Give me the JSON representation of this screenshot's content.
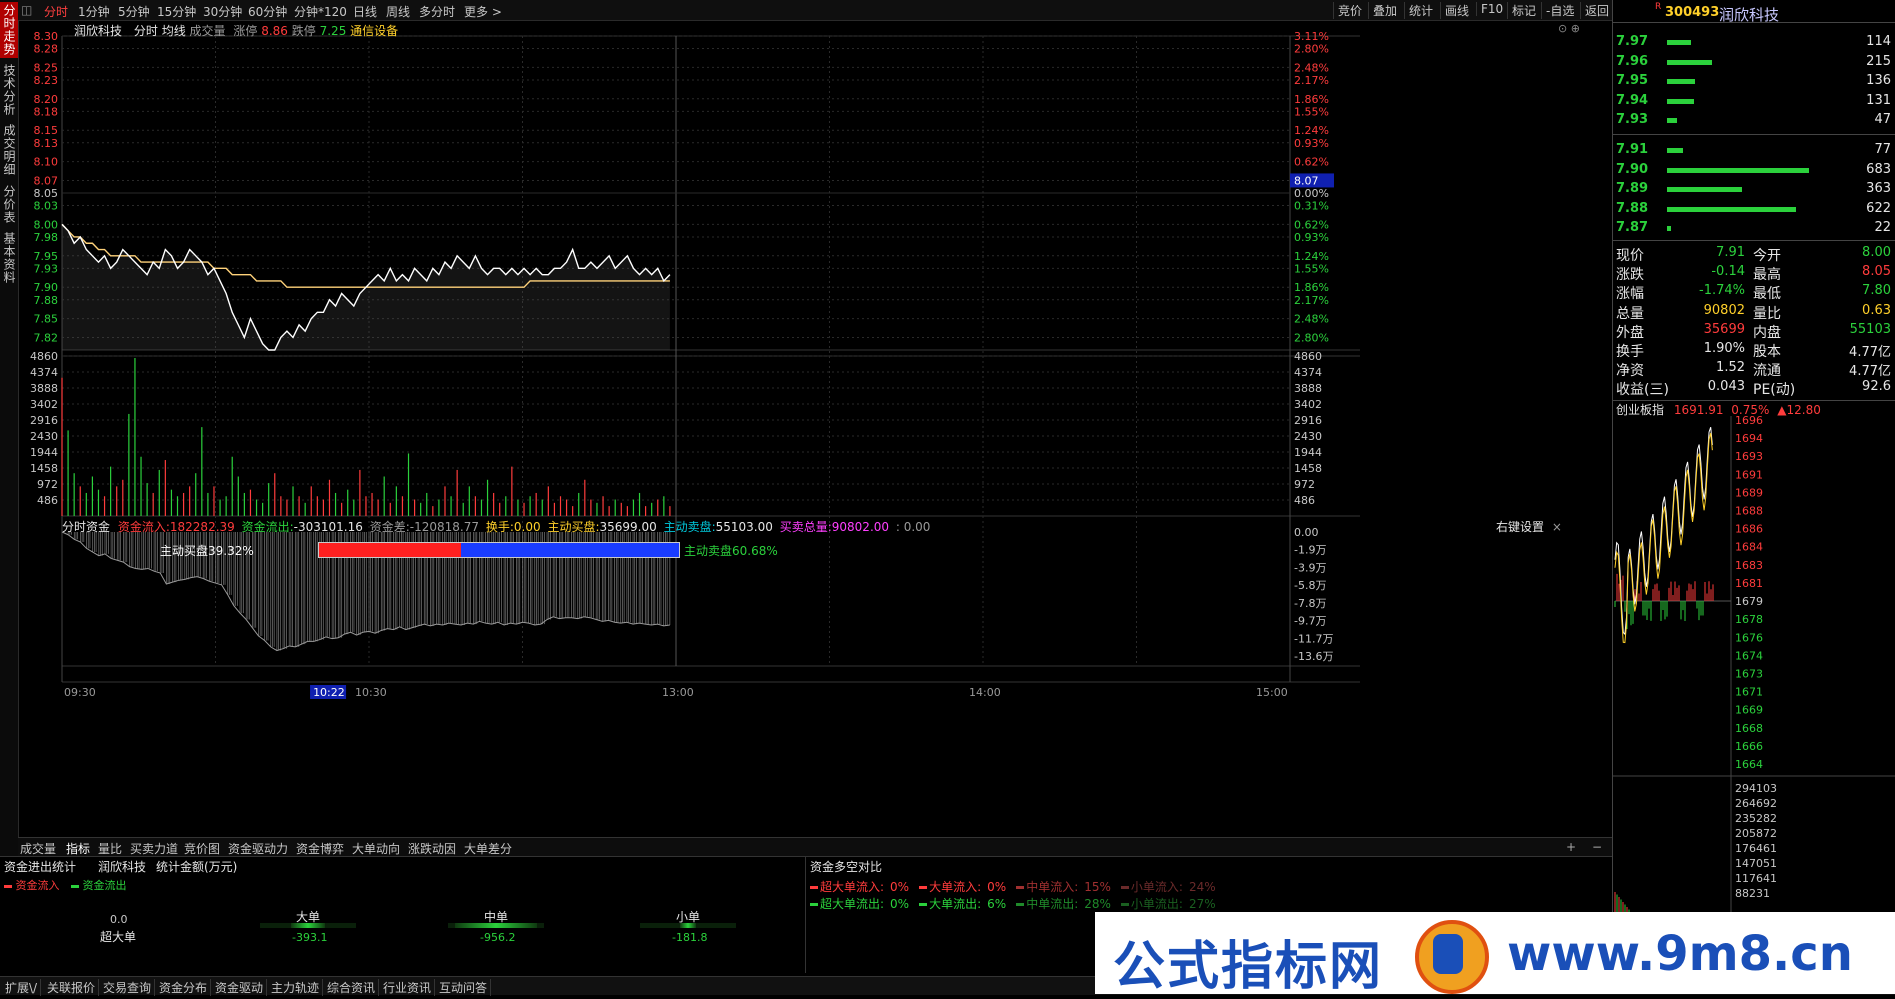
{
  "left_tabs": [
    "分时走势",
    "技术分析",
    "成交明细",
    "分价表",
    "基本资料"
  ],
  "top_toolbar": {
    "periods": [
      "分时",
      "1分钟",
      "5分钟",
      "15分钟",
      "30分钟",
      "60分钟",
      "分钟*120",
      "日线",
      "周线",
      "多分时",
      "更多 >"
    ],
    "right_buttons": [
      "竞价",
      "叠加",
      "统计",
      "画线",
      "F10",
      "标记",
      "-自选",
      "返回"
    ]
  },
  "price_header": {
    "name": "润欣科技",
    "items": [
      "分时",
      "均线",
      "成交量"
    ],
    "limit_up_label": "涨停",
    "limit_up": "8.86",
    "limit_down_label": "跌停",
    "limit_down": "7.25",
    "industry": "通信设备"
  },
  "price_axis": {
    "left_ticks": [
      "8.30",
      "8.28",
      "8.25",
      "8.23",
      "8.20",
      "8.18",
      "8.15",
      "8.13",
      "8.10",
      "8.07",
      "8.05",
      "8.03",
      "8.00",
      "7.98",
      "7.95",
      "7.93",
      "7.90",
      "7.88",
      "7.85",
      "7.82"
    ],
    "right_ticks": [
      "3.11%",
      "2.80%",
      "2.48%",
      "2.17%",
      "1.86%",
      "1.55%",
      "1.24%",
      "0.93%",
      "0.62%",
      "",
      "0.00%",
      "0.31%",
      "0.62%",
      "0.93%",
      "1.24%",
      "1.55%",
      "1.86%",
      "2.17%",
      "2.48%",
      "2.80%"
    ],
    "cursor_price": "8.07"
  },
  "volume_axis": {
    "ticks": [
      "4860",
      "4374",
      "3888",
      "3402",
      "2916",
      "2430",
      "1944",
      "1458",
      "972",
      "486"
    ]
  },
  "fund_header": {
    "title": "分时资金",
    "inflow_label": "资金流入:",
    "inflow": "182282.39",
    "outflow_label": "资金流出:",
    "outflow": "-303101.16",
    "diff_label": "资金差:",
    "diff": "-120818.77",
    "turnover_label": "换手:",
    "turnover": "0.00",
    "active_buy_label": "主动买盘:",
    "active_buy": "35699.00",
    "active_sell_label": "主动卖盘:",
    "active_sell": "55103.00",
    "total_label": "买卖总量:",
    "total": "90802.00",
    "extra": ": 0.00",
    "settings": "右键设置"
  },
  "fund_axis": {
    "ticks": [
      "0.00",
      "-1.9万",
      "-3.9万",
      "-5.8万",
      "-7.8万",
      "-9.7万",
      "-11.7万",
      "-13.6万"
    ]
  },
  "buy_sell_bar": {
    "buy_label": "主动买盘39.32%",
    "sell_label": "主动卖盘60.68%",
    "buy_fraction": 0.3932
  },
  "time_axis": {
    "labels": [
      "09:30",
      "10:30",
      "13:00",
      "14:00",
      "15:00"
    ],
    "cursor": "10:22"
  },
  "bottom_tabs": [
    "成交量",
    "指标",
    "量比",
    "买卖力道",
    "竞价图",
    "资金驱动力",
    "资金博弈",
    "大单动向",
    "涨跌动因",
    "大单差分"
  ],
  "fund_stats": {
    "title": "资金进出统计",
    "stock": "润欣科技",
    "unit": "统计金额(万元)",
    "legend_in": "资金流入",
    "legend_out": "资金流出",
    "groups": [
      {
        "name": "超大单",
        "value": "0.0",
        "out": "",
        "fill": 0.0
      },
      {
        "name": "大单",
        "value": "",
        "out": "-393.1",
        "fill": 0.35
      },
      {
        "name": "中单",
        "value": "",
        "out": "-956.2",
        "fill": 0.85
      },
      {
        "name": "小单",
        "value": "",
        "out": "-181.8",
        "fill": 0.16
      }
    ]
  },
  "fund_compare": {
    "title": "资金多空对比",
    "row1": [
      {
        "label": "超大单流入:",
        "value": "0%",
        "color": "#ff3c3c"
      },
      {
        "label": "大单流入:",
        "value": "0%",
        "color": "#ff3c3c"
      },
      {
        "label": "中单流入:",
        "value": "15%",
        "color": "#a03030"
      },
      {
        "label": "小单流入:",
        "value": "24%",
        "color": "#6a2a2a"
      }
    ],
    "row2": [
      {
        "label": "超大单流出:",
        "value": "0%",
        "color": "#2bd13c"
      },
      {
        "label": "大单流出:",
        "value": "6%",
        "color": "#2bd13c"
      },
      {
        "label": "中单流出:",
        "value": "28%",
        "color": "#1f8a2a"
      },
      {
        "label": "小单流出:",
        "value": "27%",
        "color": "#1a5f20"
      }
    ]
  },
  "status_bar": [
    "扩展\\/",
    "关联报价",
    "交易查询",
    "资金分布",
    "资金驱动",
    "主力轨迹",
    "综合资讯",
    "行业资讯",
    "互动问答"
  ],
  "quote": {
    "code": "300493",
    "name": "润欣科技",
    "badge": "R",
    "asks": [
      {
        "price": "7.97",
        "vol": "114",
        "fill": 0.17
      },
      {
        "price": "7.96",
        "vol": "215",
        "fill": 0.32
      },
      {
        "price": "7.95",
        "vol": "136",
        "fill": 0.2
      },
      {
        "price": "7.94",
        "vol": "131",
        "fill": 0.19
      },
      {
        "price": "7.93",
        "vol": "47",
        "fill": 0.07
      }
    ],
    "bids": [
      {
        "price": "7.91",
        "vol": "77",
        "fill": 0.11
      },
      {
        "price": "7.90",
        "vol": "683",
        "fill": 1.0
      },
      {
        "price": "7.89",
        "vol": "363",
        "fill": 0.53
      },
      {
        "price": "7.88",
        "vol": "622",
        "fill": 0.91
      },
      {
        "price": "7.87",
        "vol": "22",
        "fill": 0.03
      }
    ],
    "stats": [
      {
        "l1": "现价",
        "v1": "7.91",
        "c1": "#2bd13c",
        "l2": "今开",
        "v2": "8.00",
        "c2": "#2bd13c"
      },
      {
        "l1": "涨跌",
        "v1": "-0.14",
        "c1": "#2bd13c",
        "l2": "最高",
        "v2": "8.05",
        "c2": "#ff3c3c"
      },
      {
        "l1": "涨幅",
        "v1": "-1.74%",
        "c1": "#2bd13c",
        "l2": "最低",
        "v2": "7.80",
        "c2": "#2bd13c"
      },
      {
        "l1": "总量",
        "v1": "90802",
        "c1": "#ffd02a",
        "l2": "量比",
        "v2": "0.63",
        "c2": "#ffd02a"
      },
      {
        "l1": "外盘",
        "v1": "35699",
        "c1": "#ff3c3c",
        "l2": "内盘",
        "v2": "55103",
        "c2": "#2bd13c"
      },
      {
        "l1": "换手",
        "v1": "1.90%",
        "c1": "#e6e6e6",
        "l2": "股本",
        "v2": "4.77亿",
        "c2": "#e6e6e6"
      },
      {
        "l1": "净资",
        "v1": "1.52",
        "c1": "#e6e6e6",
        "l2": "流通",
        "v2": "4.77亿",
        "c2": "#e6e6e6"
      },
      {
        "l1": "收益(三)",
        "v1": "0.043",
        "c1": "#e6e6e6",
        "l2": "PE(动)",
        "v2": "92.6",
        "c2": "#e6e6e6"
      }
    ]
  },
  "index_panel": {
    "name": "创业板指",
    "value": "1691.91",
    "pct": "0.75%",
    "chg": "▲12.80",
    "ticks": [
      "1696",
      "1694",
      "1693",
      "1691",
      "1689",
      "1688",
      "1686",
      "1684",
      "1683",
      "1681",
      "1679",
      "1678",
      "1676",
      "1674",
      "1673",
      "1671",
      "1669",
      "1668",
      "1666",
      "1664"
    ],
    "vol_ticks": [
      "294103",
      "264692",
      "235282",
      "205872",
      "176461",
      "147051",
      "117641",
      "88231"
    ]
  },
  "watermark": {
    "text": "公式指标网",
    "url": "www.9m8.cn"
  },
  "chart_data": {
    "type": "line",
    "title": "",
    "prev_close": 8.05,
    "ylim": [
      7.8,
      8.3
    ],
    "times_hint": "09:30-15:00",
    "price": [
      8.0,
      7.99,
      7.97,
      7.98,
      7.96,
      7.95,
      7.94,
      7.95,
      7.93,
      7.94,
      7.96,
      7.95,
      7.94,
      7.93,
      7.92,
      7.94,
      7.93,
      7.96,
      7.95,
      7.93,
      7.94,
      7.96,
      7.95,
      7.94,
      7.92,
      7.93,
      7.91,
      7.89,
      7.86,
      7.84,
      7.82,
      7.85,
      7.83,
      7.81,
      7.8,
      7.8,
      7.82,
      7.83,
      7.82,
      7.84,
      7.83,
      7.85,
      7.86,
      7.86,
      7.88,
      7.87,
      7.89,
      7.88,
      7.87,
      7.89,
      7.9,
      7.91,
      7.92,
      7.91,
      7.93,
      7.91,
      7.92,
      7.91,
      7.93,
      7.92,
      7.91,
      7.93,
      7.92,
      7.94,
      7.93,
      7.95,
      7.94,
      7.93,
      7.95,
      7.93,
      7.92,
      7.93,
      7.93,
      7.92,
      7.93,
      7.92,
      7.93,
      7.92,
      7.93,
      7.92,
      7.92,
      7.93,
      7.93,
      7.94,
      7.96,
      7.93,
      7.93,
      7.94,
      7.93,
      7.94,
      7.95,
      7.93,
      7.94,
      7.95,
      7.93,
      7.92,
      7.93,
      7.92,
      7.93,
      7.91,
      7.92
    ],
    "avg": [
      8.0,
      7.99,
      7.98,
      7.98,
      7.97,
      7.97,
      7.96,
      7.96,
      7.95,
      7.95,
      7.95,
      7.95,
      7.95,
      7.94,
      7.94,
      7.94,
      7.94,
      7.94,
      7.94,
      7.94,
      7.94,
      7.94,
      7.94,
      7.94,
      7.94,
      7.93,
      7.93,
      7.93,
      7.92,
      7.92,
      7.92,
      7.92,
      7.91,
      7.91,
      7.91,
      7.91,
      7.91,
      7.9,
      7.9,
      7.9,
      7.9,
      7.9,
      7.9,
      7.9,
      7.9,
      7.9,
      7.9,
      7.9,
      7.9,
      7.9,
      7.9,
      7.9,
      7.9,
      7.9,
      7.9,
      7.9,
      7.9,
      7.9,
      7.9,
      7.9,
      7.9,
      7.9,
      7.9,
      7.9,
      7.9,
      7.9,
      7.9,
      7.9,
      7.9,
      7.9,
      7.9,
      7.9,
      7.9,
      7.9,
      7.9,
      7.9,
      7.9,
      7.91,
      7.91,
      7.91,
      7.91,
      7.91,
      7.91,
      7.91,
      7.91,
      7.91,
      7.91,
      7.91,
      7.91,
      7.91,
      7.91,
      7.91,
      7.91,
      7.91,
      7.91,
      7.91,
      7.91,
      7.91,
      7.91,
      7.91,
      7.91
    ],
    "volume": [
      4200,
      2600,
      1300,
      900,
      700,
      1200,
      800,
      600,
      1500,
      900,
      1100,
      3100,
      4800,
      1800,
      1000,
      700,
      1400,
      1700,
      800,
      600,
      700,
      900,
      1300,
      2700,
      700,
      900,
      500,
      600,
      1800,
      1200,
      700,
      800,
      500,
      400,
      1000,
      1300,
      600,
      500,
      900,
      600,
      400,
      900,
      600,
      500,
      1100,
      700,
      400,
      800,
      500,
      1400,
      600,
      700,
      500,
      1200,
      400,
      900,
      600,
      1900,
      500,
      400,
      700,
      300,
      500,
      900,
      600,
      1400,
      400,
      900,
      600,
      500,
      1100,
      700,
      400,
      600,
      1500,
      500,
      400,
      600,
      700,
      500,
      900,
      400,
      600,
      500,
      300,
      700,
      1100,
      500,
      400,
      600,
      300,
      500,
      400,
      300,
      500,
      700,
      300,
      400,
      500,
      600,
      300
    ],
    "fund_diff": [
      0,
      -0.3,
      -0.8,
      -1.1,
      -1.8,
      -2.2,
      -2.6,
      -2.4,
      -2.9,
      -3.1,
      -3.3,
      -3.8,
      -4.0,
      -4.1,
      -4.0,
      -4.3,
      -4.5,
      -5.7,
      -5.5,
      -5.3,
      -5.2,
      -5.0,
      -4.9,
      -5.1,
      -5.4,
      -5.6,
      -5.8,
      -6.9,
      -8.1,
      -8.9,
      -9.6,
      -10.5,
      -11.4,
      -11.9,
      -12.6,
      -13.0,
      -12.8,
      -12.5,
      -12.6,
      -12.3,
      -12.0,
      -12.0,
      -11.8,
      -11.5,
      -11.7,
      -11.6,
      -11.2,
      -11.0,
      -11.3,
      -11.0,
      -10.9,
      -11.1,
      -10.8,
      -10.6,
      -10.7,
      -10.4,
      -10.7,
      -10.5,
      -10.3,
      -10.1,
      -10.3,
      -10.1,
      -10.2,
      -10.0,
      -10.1,
      -10.2,
      -10.0,
      -10.1,
      -9.8,
      -10.0,
      -10.1,
      -9.9,
      -10.2,
      -10.0,
      -10.1,
      -9.9,
      -10.0,
      -10.2,
      -10.1,
      -9.6,
      -9.3,
      -9.5,
      -9.4,
      -9.4,
      -9.5,
      -9.3,
      -9.4,
      -9.6,
      -9.8,
      -9.7,
      -9.9,
      -10.0,
      -9.9,
      -10.1,
      -10.0,
      -10.1,
      -10.2,
      -10.1,
      -10.3,
      -10.2
    ]
  }
}
